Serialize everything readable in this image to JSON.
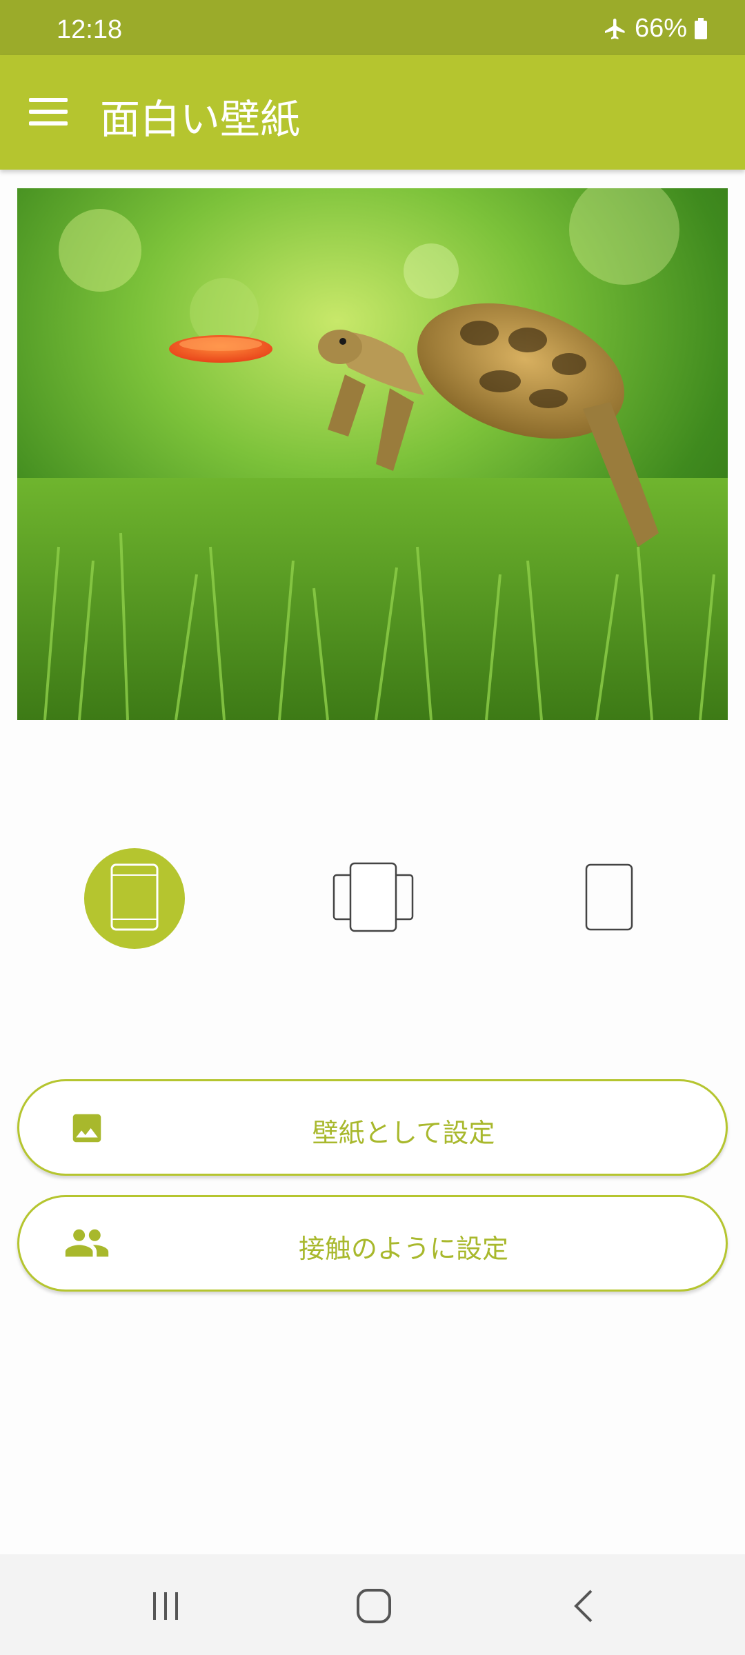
{
  "status_bar": {
    "time": "12:18",
    "battery": "66%",
    "airplane_icon": "airplane-icon",
    "battery_icon": "battery-icon"
  },
  "app_bar": {
    "title": "面白い壁紙",
    "menu_icon": "hamburger-menu-icon"
  },
  "hero": {
    "subject": "turtle-catching-frisbee-wallpaper"
  },
  "mode_selector": {
    "items": [
      {
        "id": "home",
        "icon": "home-screen-icon",
        "selected": true
      },
      {
        "id": "both",
        "icon": "both-screens-icon",
        "selected": false
      },
      {
        "id": "lock",
        "icon": "lock-screen-icon",
        "selected": false
      }
    ]
  },
  "actions": {
    "set_wallpaper": {
      "label": "壁紙として設定",
      "icon": "image-icon"
    },
    "set_contact": {
      "label": "接触のように設定",
      "icon": "contacts-icon"
    }
  },
  "nav_bar": {
    "recents_icon": "recents-icon",
    "home_icon": "home-icon",
    "back_icon": "back-icon"
  },
  "colors": {
    "accent": "#b5c52f",
    "status_bar": "#9bab2a",
    "button_text": "#a8b82c"
  }
}
